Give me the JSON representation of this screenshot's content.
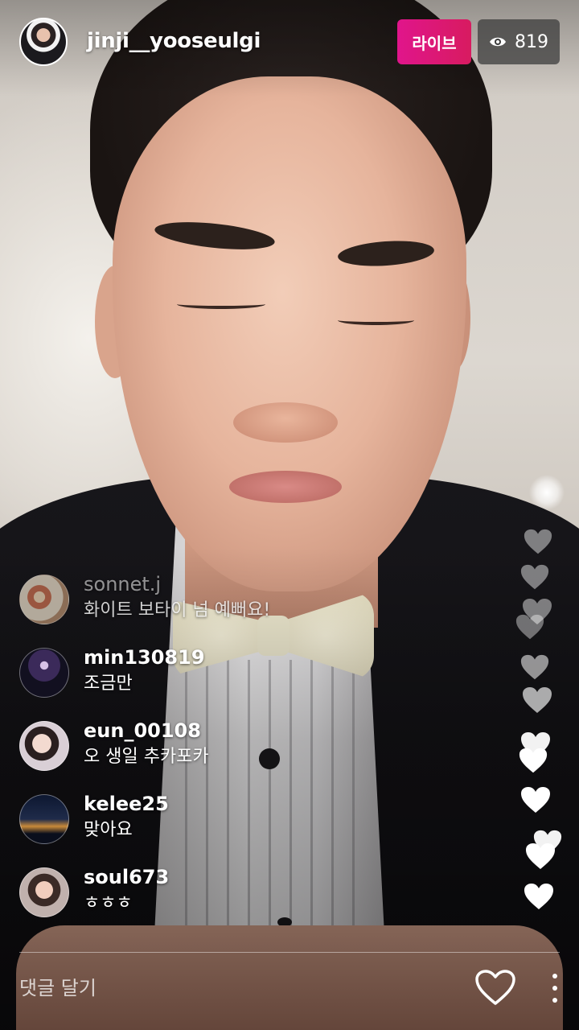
{
  "header": {
    "host_username": "jinji__yooseulgi",
    "live_label": "라이브",
    "viewer_count": "819"
  },
  "comments": [
    {
      "username": "sonnet.j",
      "text": "화이트 보타이 넘 예뻐요!",
      "faded": true
    },
    {
      "username": "min130819",
      "text": "조금만",
      "faded": false
    },
    {
      "username": "eun_00108",
      "text": "오 생일 추카포카",
      "faded": false
    },
    {
      "username": "kelee25",
      "text": "맞아요",
      "faded": false
    },
    {
      "username": "soul673",
      "text": "ㅎㅎㅎ",
      "faded": false
    }
  ],
  "footer": {
    "comment_placeholder": "댓글 달기"
  },
  "icons": {
    "viewer": "eye-icon",
    "like": "heart-outline-icon",
    "more": "more-vertical-icon",
    "floating": "heart-icon"
  },
  "colors": {
    "live_badge_start": "#e0158b",
    "live_badge_end": "#d81b60",
    "accent_white": "#ffffff"
  }
}
